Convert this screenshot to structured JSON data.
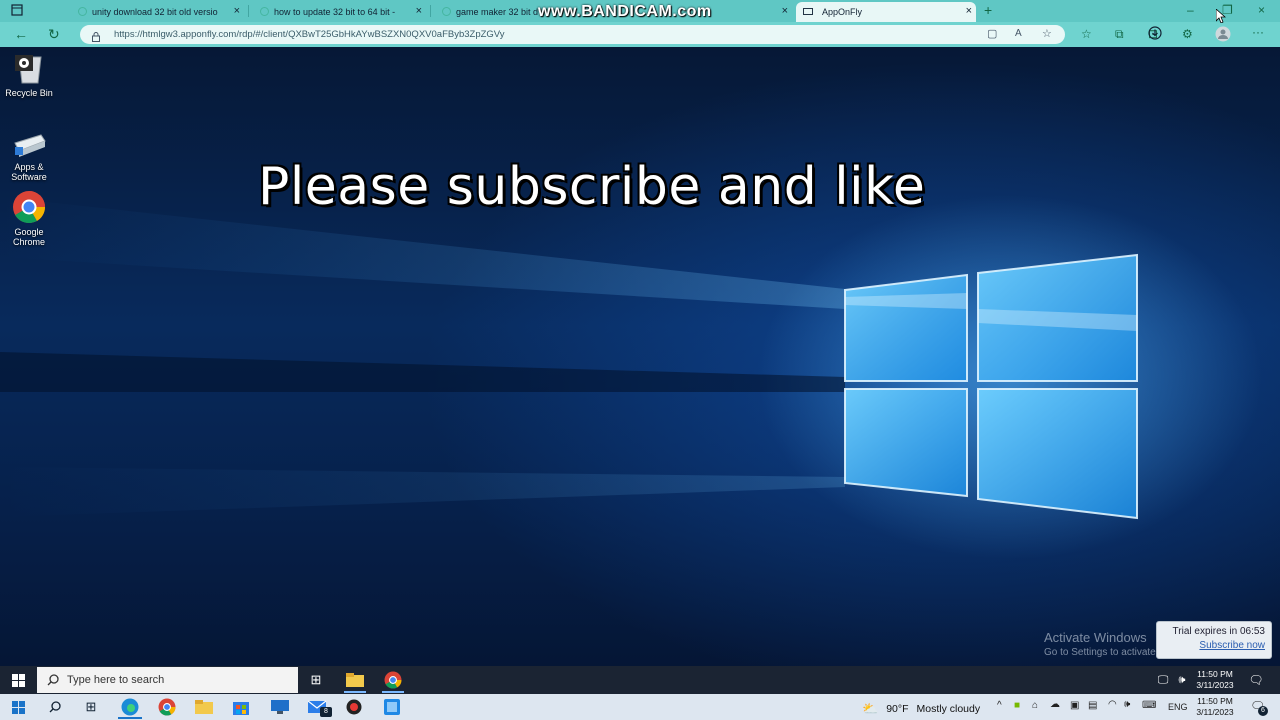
{
  "browser": {
    "tabs": [
      {
        "label": "unity download 32 bit old versio",
        "active": false
      },
      {
        "label": "how to update 32 bit to 64 bit -",
        "active": false
      },
      {
        "label": "game maker 32 bit d",
        "active": false
      },
      {
        "label": "AppOnFly",
        "active": true
      }
    ],
    "new_tab_label": "+",
    "url": "https://htmlgw3.apponfly.com/rdp/#/client/QXBwT25GbHkAYwBSZXN0QXV0aFByb3ZpZGVy",
    "watermark": "www.BANDICAM.com"
  },
  "desktop": {
    "icons": [
      {
        "label": "Recycle Bin",
        "icon": "recycle-bin-icon"
      },
      {
        "label": "Apps & Software",
        "icon": "apps-software-icon"
      },
      {
        "label": "Google Chrome",
        "icon": "chrome-icon"
      }
    ],
    "overlay_text": "Please subscribe and like",
    "activate_line1": "Activate Windows",
    "activate_line2": "Go to Settings to activate Windows.",
    "trial_text": "Trial expires in 06:53",
    "trial_link": "Subscribe now"
  },
  "remote_taskbar": {
    "search_placeholder": "Type here to search",
    "time": "11:50 PM",
    "date": "3/11/2023"
  },
  "host_taskbar": {
    "weather_temp": "90°F",
    "weather_text": "Mostly cloudy",
    "language": "ENG",
    "time": "11:50 PM",
    "date": "3/11/2023",
    "notification_count": "6",
    "mail_badge": "8"
  },
  "colors": {
    "tabbar": "#5fc7c4",
    "addressbar": "#6fd3cf",
    "desktop_accent": "#3aa0ff",
    "remote_taskbar": "#1b2433",
    "host_taskbar": "#dde6f0"
  }
}
